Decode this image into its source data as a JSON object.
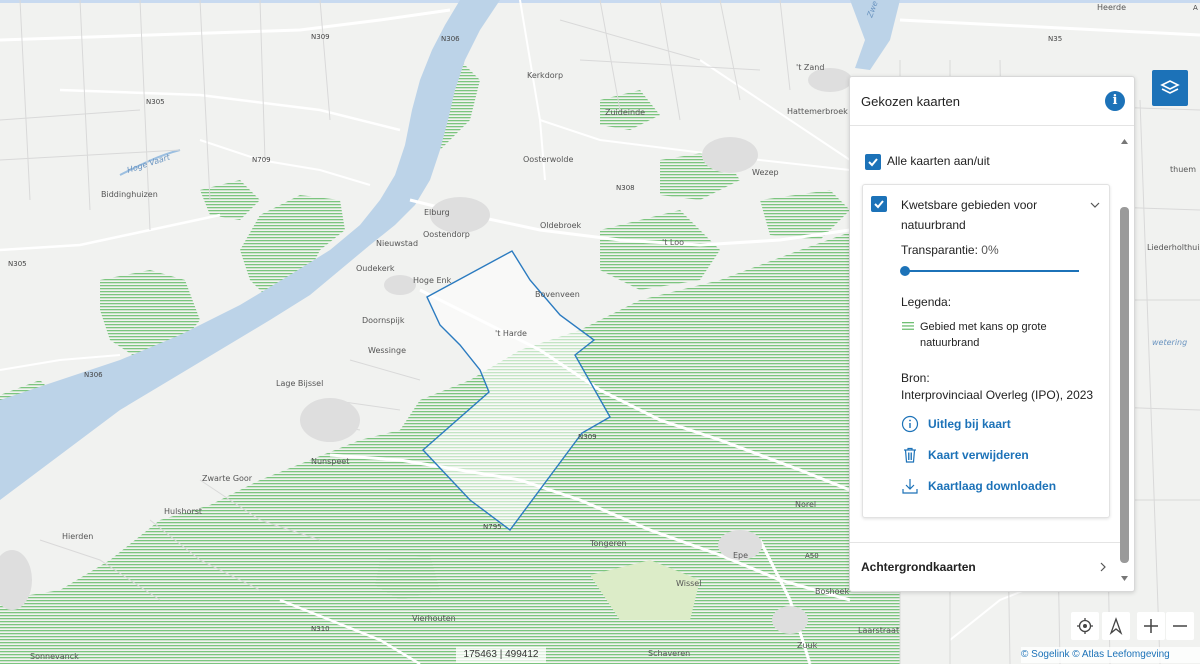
{
  "map": {
    "labels": {
      "kerkdorp": "Kerkdorp",
      "zuideinde": "Zuideinde",
      "hattemerbroek": "Hattemerbroek",
      "oosterwolde": "Oosterwolde",
      "wezep": "Wezep",
      "biddinghuizen": "Biddinghuizen",
      "elburg": "Elburg",
      "oostendorp": "Oostendorp",
      "oldebroek": "Oldebroek",
      "nieuwstad": "Nieuwstad",
      "oudekerk": "Oudekerk",
      "hoge_enk": "Hoge Enk",
      "tloo": "'t Loo",
      "bovenveen": "Bovenveen",
      "doornspijk": "Doornspijk",
      "tharde": "'t Harde",
      "wessinge": "Wessinge",
      "lage_bijssel": "Lage Bijssel",
      "nunspeet": "Nunspeet",
      "zwarte_goor": "Zwarte Goor",
      "hulshorst": "Hulshorst",
      "hierden": "Hierden",
      "tongeren": "Tongeren",
      "epe": "Epe",
      "wissel": "Wissel",
      "vierhouten": "Vierhouten",
      "schaveren": "Schaveren",
      "laarstraat": "Laarstraat",
      "zuuk": "Zuuk",
      "norel": "Norel",
      "boshoek": "Boshoek",
      "sonnevanck": "Sonnevanck",
      "tzand": "'t Zand",
      "heerde": "Heerde",
      "hoge_vaart": "Hoge Vaart",
      "liederholthuis": "Liederholthuis",
      "zwolle_partial": "Zwe",
      "wetering_partial": "wetering",
      "heino_partial": "thuem"
    },
    "roads": {
      "n309": "N309",
      "n306_top": "N306",
      "n305_top": "N305",
      "n709": "N709",
      "n305_left": "N305",
      "n306_left": "N306",
      "n308": "N308",
      "n309_mid": "N309",
      "n795": "N795",
      "a50": "A50",
      "n310": "N310",
      "n35": "N35",
      "a28_partial": "A"
    }
  },
  "panel": {
    "title": "Gekozen kaarten",
    "info_icon": "info-icon",
    "all_maps_label": "Alle kaarten aan/uit",
    "layer": {
      "title": "Kwetsbare gebieden voor natuurbrand",
      "transparency_label": "Transparantie:",
      "transparency_value": "0%",
      "transparency_percent": 0,
      "legend_title": "Legenda:",
      "legend_item": "Gebied met kans op grote natuurbrand",
      "legend_color": "#6fbf73",
      "source_label": "Bron:",
      "source_value": "Interprovinciaal Overleg (IPO), 2023",
      "actions": {
        "explain": "Uitleg bij kaart",
        "remove": "Kaart verwijderen",
        "download": "Kaartlaag downloaden"
      }
    },
    "background_maps_label": "Achtergrondkaarten"
  },
  "coordinates": "175463 | 499412",
  "attribution": {
    "sogelink": "© Sogelink",
    "atlas": "© Atlas Leefomgeving"
  },
  "colors": {
    "accent": "#1c72b8",
    "water": "#bcd3e8",
    "hatch": "#6fbf73"
  }
}
